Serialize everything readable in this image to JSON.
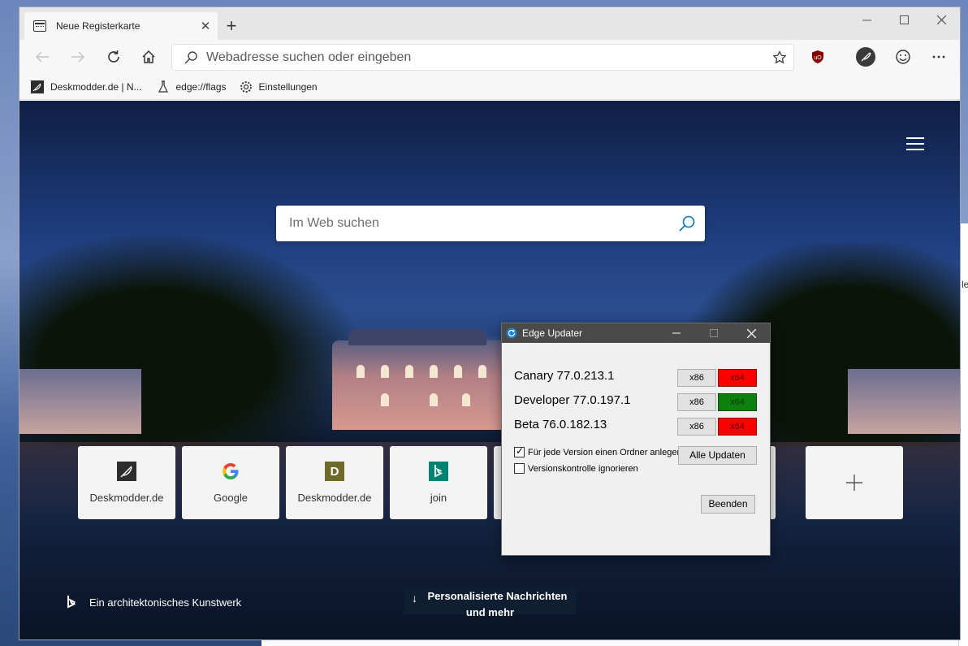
{
  "tab": {
    "title": "Neue Registerkarte",
    "close": "✕",
    "new_tab": "+"
  },
  "window": {
    "minimize": "—",
    "maximize": "☐",
    "close": "✕"
  },
  "address": {
    "placeholder": "Webadresse suchen oder eingeben"
  },
  "favorites": [
    {
      "label": "Deskmodder.de | N...",
      "icon": "feather-icon"
    },
    {
      "label": "edge://flags",
      "icon": "flask-icon"
    },
    {
      "label": "Einstellungen",
      "icon": "gear-icon"
    }
  ],
  "ntp": {
    "search_placeholder": "Im Web suchen",
    "tiles": [
      {
        "label": "Deskmodder.de",
        "icon": "feather-icon"
      },
      {
        "label": "Google",
        "icon": "google-icon"
      },
      {
        "label": "Deskmodder.de",
        "icon": "d-letter-icon",
        "letter": "D"
      },
      {
        "label": "join",
        "icon": "bing-icon"
      }
    ],
    "add_tile": "+",
    "image_caption": "Ein architektonisches Kunstwerk",
    "news_button_line1": "Personalisierte Nachrichten",
    "news_button_line2": "und mehr",
    "news_arrow": "↓"
  },
  "updater": {
    "title": "Edge Updater",
    "versions": [
      {
        "name": "Canary 77.0.213.1",
        "x86": "x86",
        "x64": "x64",
        "x64_status": "red"
      },
      {
        "name": "Developer 77.0.197.1",
        "x86": "x86",
        "x64": "x64",
        "x64_status": "green"
      },
      {
        "name": "Beta 76.0.182.13",
        "x86": "x86",
        "x64": "x64",
        "x64_status": "red"
      }
    ],
    "checkbox_folder": {
      "label": "Für jede Version einen Ordner anlegen",
      "checked": true
    },
    "checkbox_version_control": {
      "label": "Versionskontrolle ignorieren",
      "checked": false
    },
    "update_all": "Alle Updaten",
    "quit": "Beenden",
    "status_colors": {
      "red": "#ff0000",
      "green": "#0e800e"
    }
  },
  "background_peek": "le"
}
